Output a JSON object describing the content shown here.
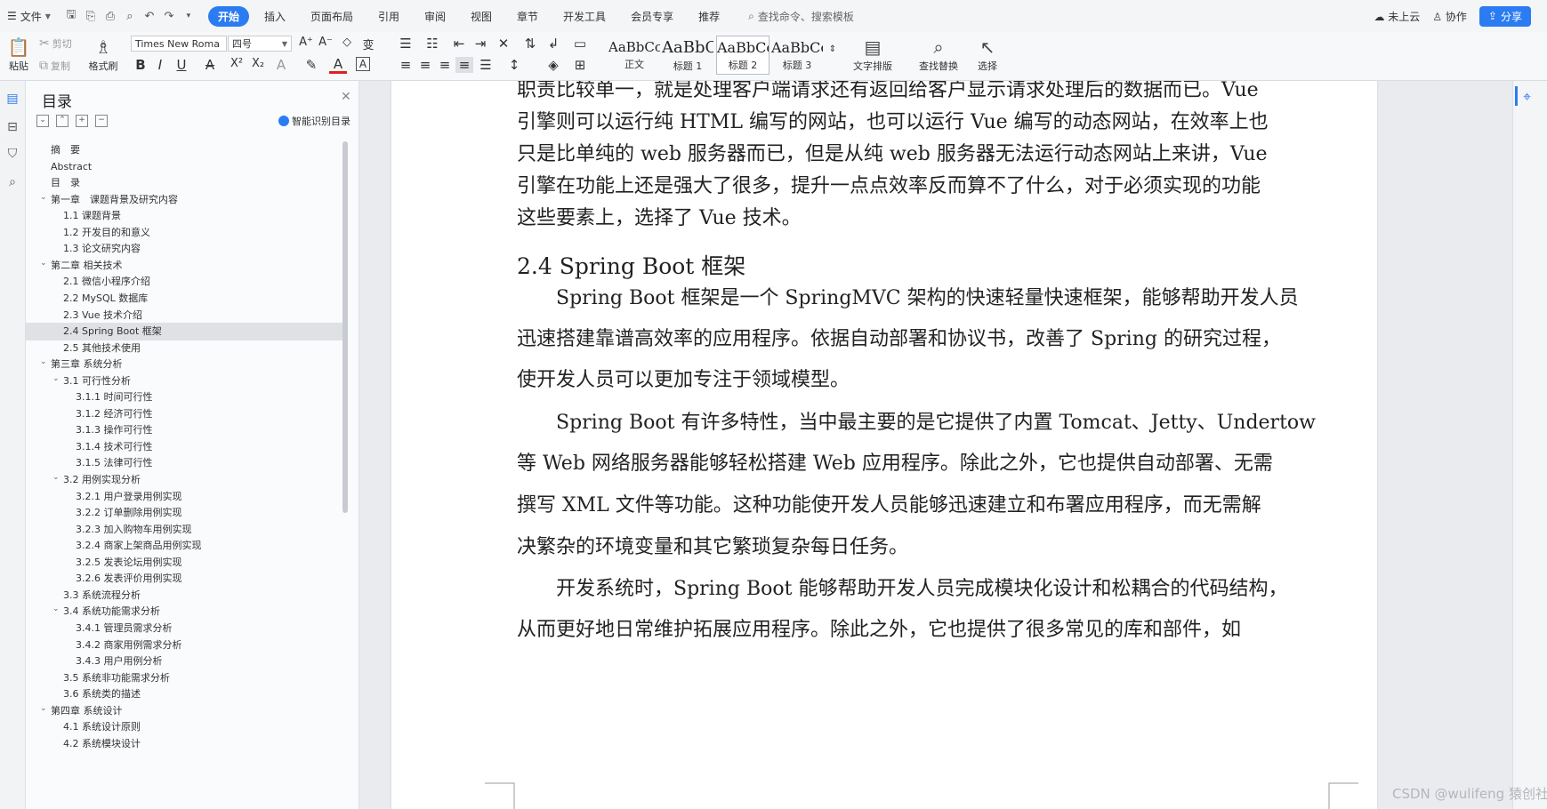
{
  "menubar": {
    "file": "文件",
    "tabs": [
      "开始",
      "插入",
      "页面布局",
      "引用",
      "审阅",
      "视图",
      "章节",
      "开发工具",
      "会员专享",
      "推荐"
    ],
    "active_tab": "开始",
    "search": "查找命令、搜索模板",
    "cloud": "未上云",
    "collab": "协作",
    "share": "分享"
  },
  "ribbon": {
    "paste": "粘贴",
    "cut": "剪切",
    "copy": "复制",
    "format_painter": "格式刷",
    "font_name": "Times New Roma",
    "font_size": "四号",
    "styles": [
      {
        "sample": "AaBbCcI",
        "name": "正文"
      },
      {
        "sample": "AaBbC",
        "name": "标题 1"
      },
      {
        "sample": "AaBbCc",
        "name": "标题 2"
      },
      {
        "sample": "AaBbCc",
        "name": "标题 3"
      }
    ],
    "text_layout": "文字排版",
    "find_replace": "查找替换",
    "select": "选择"
  },
  "toc": {
    "title": "目录",
    "smart": "智能识别目录",
    "items": [
      {
        "text": "摘　要",
        "level": 0,
        "chev": false
      },
      {
        "text": "Abstract",
        "level": 0,
        "chev": false
      },
      {
        "text": "目　录",
        "level": 0,
        "chev": false
      },
      {
        "text": "第一章　课题背景及研究内容",
        "level": 0,
        "chev": true
      },
      {
        "text": "1.1 课题背景",
        "level": 1,
        "chev": false
      },
      {
        "text": "1.2 开发目的和意义",
        "level": 1,
        "chev": false
      },
      {
        "text": "1.3 论文研究内容",
        "level": 1,
        "chev": false
      },
      {
        "text": "第二章 相关技术",
        "level": 0,
        "chev": true
      },
      {
        "text": "2.1 微信小程序介绍",
        "level": 1,
        "chev": false
      },
      {
        "text": "2.2 MySQL 数据库",
        "level": 1,
        "chev": false
      },
      {
        "text": "2.3 Vue 技术介绍",
        "level": 1,
        "chev": false
      },
      {
        "text": "2.4 Spring Boot 框架",
        "level": 1,
        "chev": false,
        "selected": true
      },
      {
        "text": "2.5 其他技术使用",
        "level": 1,
        "chev": false
      },
      {
        "text": "第三章 系统分析",
        "level": 0,
        "chev": true
      },
      {
        "text": "3.1 可行性分析",
        "level": 1,
        "chev": true
      },
      {
        "text": "3.1.1 时间可行性",
        "level": 2,
        "chev": false
      },
      {
        "text": "3.1.2 经济可行性",
        "level": 2,
        "chev": false
      },
      {
        "text": "3.1.3 操作可行性",
        "level": 2,
        "chev": false
      },
      {
        "text": "3.1.4 技术可行性",
        "level": 2,
        "chev": false
      },
      {
        "text": "3.1.5 法律可行性",
        "level": 2,
        "chev": false
      },
      {
        "text": "3.2 用例实现分析",
        "level": 1,
        "chev": true
      },
      {
        "text": "3.2.1 用户登录用例实现",
        "level": 2,
        "chev": false
      },
      {
        "text": "3.2.2 订单删除用例实现",
        "level": 2,
        "chev": false
      },
      {
        "text": "3.2.3 加入购物车用例实现",
        "level": 2,
        "chev": false
      },
      {
        "text": "3.2.4 商家上架商品用例实现",
        "level": 2,
        "chev": false
      },
      {
        "text": "3.2.5 发表论坛用例实现",
        "level": 2,
        "chev": false
      },
      {
        "text": "3.2.6 发表评价用例实现",
        "level": 2,
        "chev": false
      },
      {
        "text": "3.3 系统流程分析",
        "level": 1,
        "chev": false
      },
      {
        "text": "3.4 系统功能需求分析",
        "level": 1,
        "chev": true
      },
      {
        "text": "3.4.1 管理员需求分析",
        "level": 2,
        "chev": false
      },
      {
        "text": "3.4.2 商家用例需求分析",
        "level": 2,
        "chev": false
      },
      {
        "text": "3.4.3 用户用例分析",
        "level": 2,
        "chev": false
      },
      {
        "text": "3.5 系统非功能需求分析",
        "level": 1,
        "chev": false
      },
      {
        "text": "3.6 系统类的描述",
        "level": 1,
        "chev": false
      },
      {
        "text": "第四章 系统设计",
        "level": 0,
        "chev": true
      },
      {
        "text": "4.1 系统设计原则",
        "level": 1,
        "chev": false
      },
      {
        "text": "4.2 系统模块设计",
        "level": 1,
        "chev": false
      }
    ]
  },
  "document": {
    "lines_top": [
      "职责比较单一，就是处理客户端请求还有返回给客户显示请求处理后的数据而已。Vue",
      "引擎则可以运行纯 HTML 编写的网站，也可以运行 Vue 编写的动态网站，在效率上也",
      "只是比单纯的 web 服务器而已，但是从纯 web 服务器无法运行动态网站上来讲，Vue",
      "引擎在功能上还是强大了很多，提升一点点效率反而算不了什么，对于必须实现的功能",
      "这些要素上，选择了 Vue 技术。"
    ],
    "heading": "2.4 Spring Boot 框架",
    "lines_body": [
      "　　Spring Boot 框架是一个 SpringMVC 架构的快速轻量快速框架，能够帮助开发人员",
      "迅速搭建靠谱高效率的应用程序。依据自动部署和协议书，改善了 Spring 的研究过程，",
      "使开发人员可以更加专注于领域模型。",
      "　　Spring Boot 有许多特性，当中最主要的是它提供了内置 Tomcat、Jetty、Undertow",
      "等 Web 网络服务器能够轻松搭建 Web 应用程序。除此之外，它也提供自动部署、无需",
      "撰写 XML 文件等功能。这种功能使开发人员能够迅速建立和布署应用程序，而无需解",
      "决繁杂的环境变量和其它繁琐复杂每日任务。",
      "　　开发系统时，Spring Boot 能够帮助开发人员完成模块化设计和松耦合的代码结构，",
      "从而更好地日常维护拓展应用程序。除此之外，它也提供了很多常见的库和部件，如"
    ]
  },
  "watermark": "CSDN @wulifeng 猿创社区"
}
